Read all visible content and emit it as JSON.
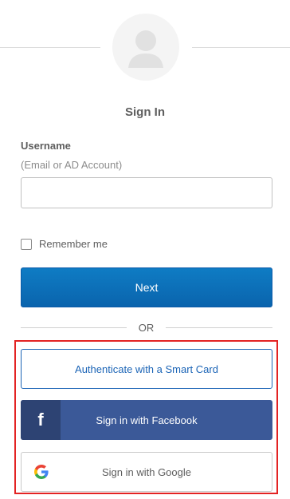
{
  "header": {
    "title": "Sign In"
  },
  "username": {
    "label": "Username",
    "hint": "(Email or AD Account)",
    "value": "",
    "placeholder": ""
  },
  "remember": {
    "label": "Remember me",
    "checked": false
  },
  "buttons": {
    "next": "Next",
    "smart_card": "Authenticate with a Smart Card",
    "facebook": "Sign in with Facebook",
    "google": "Sign in with Google"
  },
  "separator": {
    "or": "OR"
  },
  "icons": {
    "avatar": "user-avatar-icon",
    "facebook": "facebook-icon",
    "google": "google-icon"
  },
  "colors": {
    "primary": "#0f7cc4",
    "facebook": "#3b5998",
    "facebook_dark": "#2d4373",
    "smart_card_text": "#1b64b6",
    "highlight": "#e32323"
  }
}
